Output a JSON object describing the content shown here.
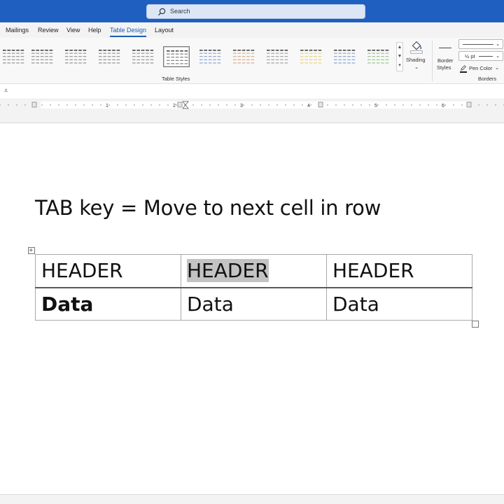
{
  "search": {
    "placeholder": "Search"
  },
  "tabs": [
    {
      "label": "Mailings"
    },
    {
      "label": "Review"
    },
    {
      "label": "View"
    },
    {
      "label": "Help"
    },
    {
      "label": "Table Design"
    },
    {
      "label": "Layout"
    }
  ],
  "active_tab": "Table Design",
  "ribbon": {
    "table_styles_label": "Table Styles",
    "shading_label": "Shading",
    "border_styles_label_1": "Border",
    "border_styles_label_2": "Styles",
    "pen_weight": "½ pt",
    "pen_color_label": "Pen Color",
    "borders_label": "Borders"
  },
  "ruler": {
    "numbers": [
      "1",
      "2",
      "3",
      "4",
      "5",
      "6"
    ]
  },
  "document": {
    "heading": "TAB key = Move to next cell in row",
    "table": {
      "rows": [
        [
          "HEADER",
          "HEADER",
          "HEADER"
        ],
        [
          "Data",
          "Data",
          "Data"
        ]
      ]
    }
  },
  "colors": {
    "titlebar": "#1f5fbf",
    "accent": "#1a5fb4",
    "cell_highlight": "#c3c3c3"
  },
  "icons": [
    "search-icon",
    "shading-bucket-icon",
    "pen-icon",
    "table-move-handle-icon",
    "table-resize-handle-icon",
    "chevron-down-icon",
    "scroll-up-icon",
    "scroll-down-icon",
    "gallery-more-icon",
    "quick-access-icon"
  ]
}
